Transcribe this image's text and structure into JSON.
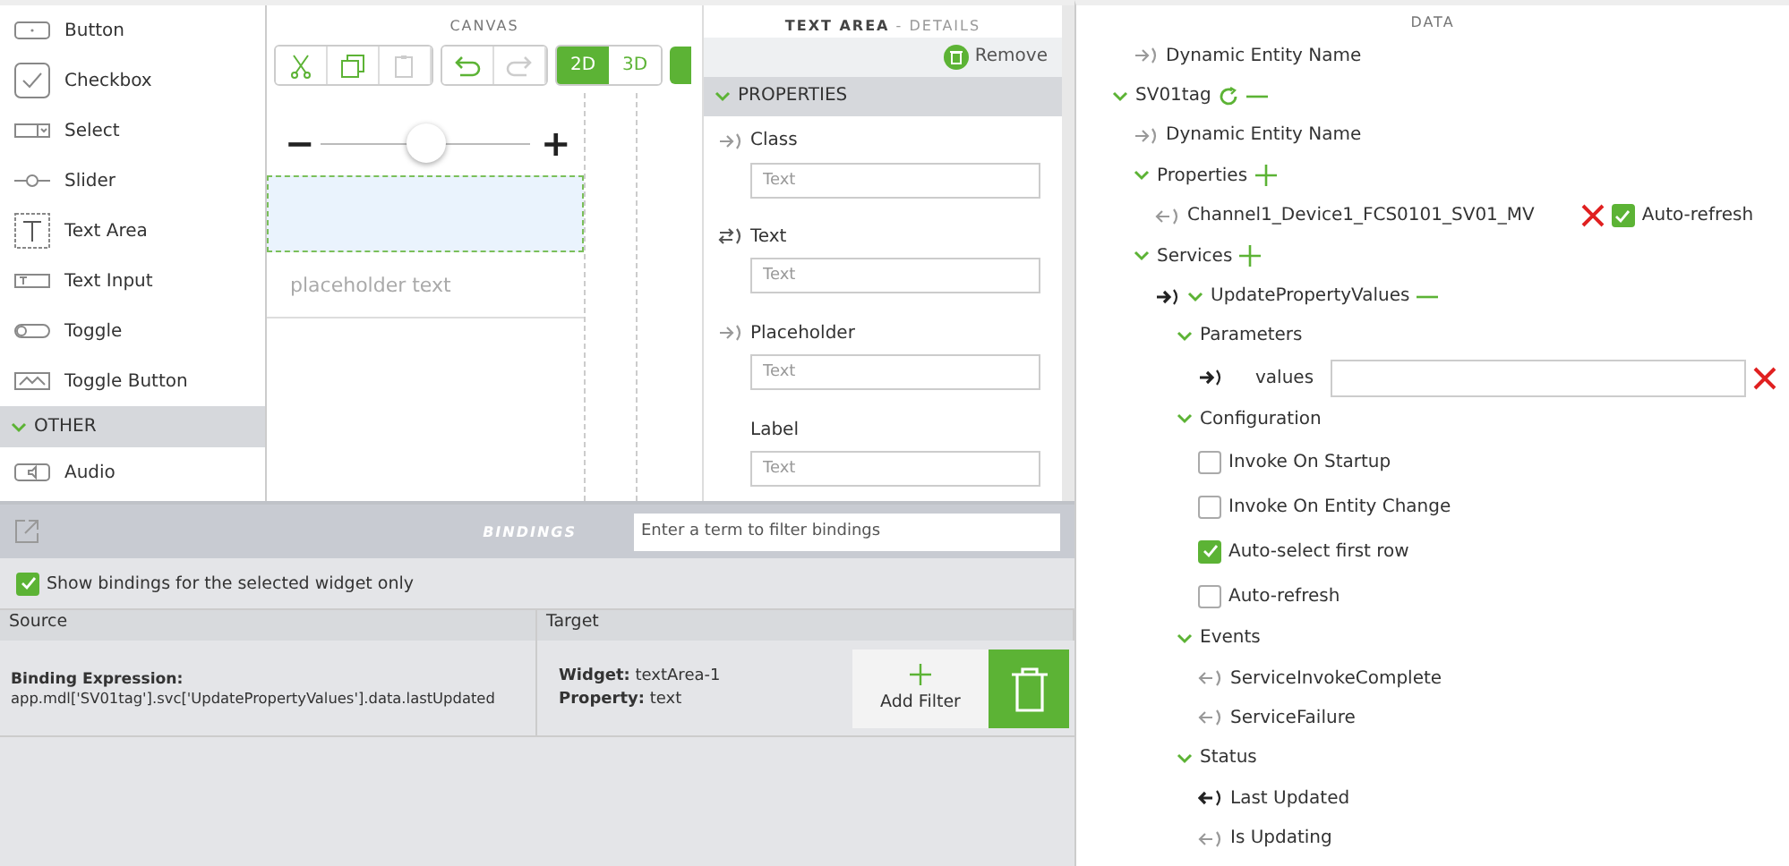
{
  "palette": {
    "items": [
      {
        "kind": "button",
        "label": "Button"
      },
      {
        "kind": "checkbox",
        "label": "Checkbox"
      },
      {
        "kind": "select",
        "label": "Select"
      },
      {
        "kind": "slider",
        "label": "Slider"
      },
      {
        "kind": "textarea",
        "label": "Text Area"
      },
      {
        "kind": "textinput",
        "label": "Text Input"
      },
      {
        "kind": "toggle",
        "label": "Toggle"
      },
      {
        "kind": "togglebutton",
        "label": "Toggle Button"
      }
    ],
    "section": {
      "label": "OTHER",
      "expanded": true,
      "items": [
        {
          "kind": "audio",
          "label": "Audio"
        }
      ]
    }
  },
  "canvas": {
    "title": "CANVAS",
    "tools": [
      {
        "kind": "cut",
        "disabled": false
      },
      {
        "kind": "copy",
        "disabled": false
      },
      {
        "kind": "paste",
        "disabled": true
      },
      {
        "kind": "undo",
        "disabled": false
      },
      {
        "kind": "redo",
        "disabled": true
      }
    ],
    "view_modes": [
      {
        "label": "2D",
        "selected": true
      },
      {
        "label": "3D",
        "selected": false
      }
    ],
    "slider": {
      "minus": "−",
      "plus": "+",
      "level": 0.5
    },
    "text_area": {
      "selected": true
    },
    "text_input": {
      "placeholder": "placeholder text"
    }
  },
  "details": {
    "title": "TEXT AREA",
    "subtitle": "- DETAILS",
    "remove": "Remove",
    "section": {
      "label": "PROPERTIES",
      "expanded": true
    },
    "fields": [
      {
        "label": "Class",
        "bind_icon": {
          "kind": "out"
        },
        "placeholder": "Text"
      },
      {
        "label": "Text",
        "bind_icon": {
          "kind": "twoway"
        },
        "placeholder": "Text"
      },
      {
        "label": "Placeholder",
        "bind_icon": {
          "kind": "out"
        },
        "placeholder": "Text"
      },
      {
        "label": "Label",
        "placeholder": "Text"
      }
    ]
  },
  "bindings": {
    "title": "BINDINGS",
    "filter": {
      "placeholder": "Enter a term to filter bindings"
    },
    "selected_only": {
      "label": "Show bindings for the selected widget only",
      "checked": true
    },
    "columns": [
      "Source",
      "Target"
    ],
    "rows": [
      {
        "source_label": "Binding Expression:",
        "source": "app.mdl['SV01tag'].svc['UpdatePropertyValues'].data.lastUpdated",
        "target": [
          "**Widget:** textArea-1",
          "**Property:** text"
        ],
        "add_filter": "Add Filter"
      }
    ]
  },
  "data": {
    "title": "DATA",
    "tree": [
      {
        "kind": "binding",
        "label": "Dynamic Entity Name",
        "incoming": false,
        "bound": false
      },
      {
        "kind": "group",
        "label": "SV01tag",
        "expanded": true,
        "actions": [
          {
            "kind": "refresh"
          },
          {
            "kind": "remove"
          }
        ],
        "children": [
          {
            "kind": "binding",
            "label": "Dynamic Entity Name",
            "incoming": false,
            "bound": false
          },
          {
            "kind": "group",
            "label": "Properties",
            "expanded": true,
            "actions": [
              {
                "kind": "add"
              }
            ],
            "children": [
              {
                "kind": "binding",
                "label": "Channel1_Device1_FCS0101_SV01_MV",
                "incoming": true,
                "bound": false,
                "removable": true,
                "auto_refresh": {
                  "label": "Auto-refresh",
                  "checked": true
                }
              }
            ]
          },
          {
            "kind": "group",
            "label": "Services",
            "expanded": true,
            "actions": [
              {
                "kind": "add"
              }
            ],
            "children": [
              {
                "kind": "group",
                "label": "UpdatePropertyValues",
                "expanded": true,
                "binding": {
                  "incoming": false,
                  "bound": true
                },
                "actions": [
                  {
                    "kind": "remove"
                  }
                ],
                "children": [
                  {
                    "kind": "group",
                    "label": "Parameters",
                    "expanded": true,
                    "children": [
                      {
                        "kind": "param",
                        "label": "values",
                        "incoming": false,
                        "bound": true,
                        "removable": true
                      }
                    ]
                  },
                  {
                    "kind": "group",
                    "label": "Configuration",
                    "expanded": true,
                    "children": [
                      {
                        "kind": "checkbox",
                        "label": "Invoke On Startup",
                        "checked": false
                      },
                      {
                        "kind": "checkbox",
                        "label": "Invoke On Entity Change",
                        "checked": false
                      },
                      {
                        "kind": "checkbox",
                        "label": "Auto-select first row",
                        "checked": true
                      },
                      {
                        "kind": "checkbox",
                        "label": "Auto-refresh",
                        "checked": false
                      }
                    ]
                  },
                  {
                    "kind": "group",
                    "label": "Events",
                    "expanded": true,
                    "children": [
                      {
                        "kind": "binding",
                        "label": "ServiceInvokeComplete",
                        "incoming": true,
                        "bound": false
                      },
                      {
                        "kind": "binding",
                        "label": "ServiceFailure",
                        "incoming": true,
                        "bound": false
                      }
                    ]
                  },
                  {
                    "kind": "group",
                    "label": "Status",
                    "expanded": true,
                    "children": [
                      {
                        "kind": "binding",
                        "label": "Last Updated",
                        "incoming": true,
                        "bound": true
                      },
                      {
                        "kind": "binding",
                        "label": "Is Updating",
                        "incoming": true,
                        "bound": false
                      }
                    ]
                  }
                ]
              }
            ]
          }
        ]
      }
    ]
  }
}
